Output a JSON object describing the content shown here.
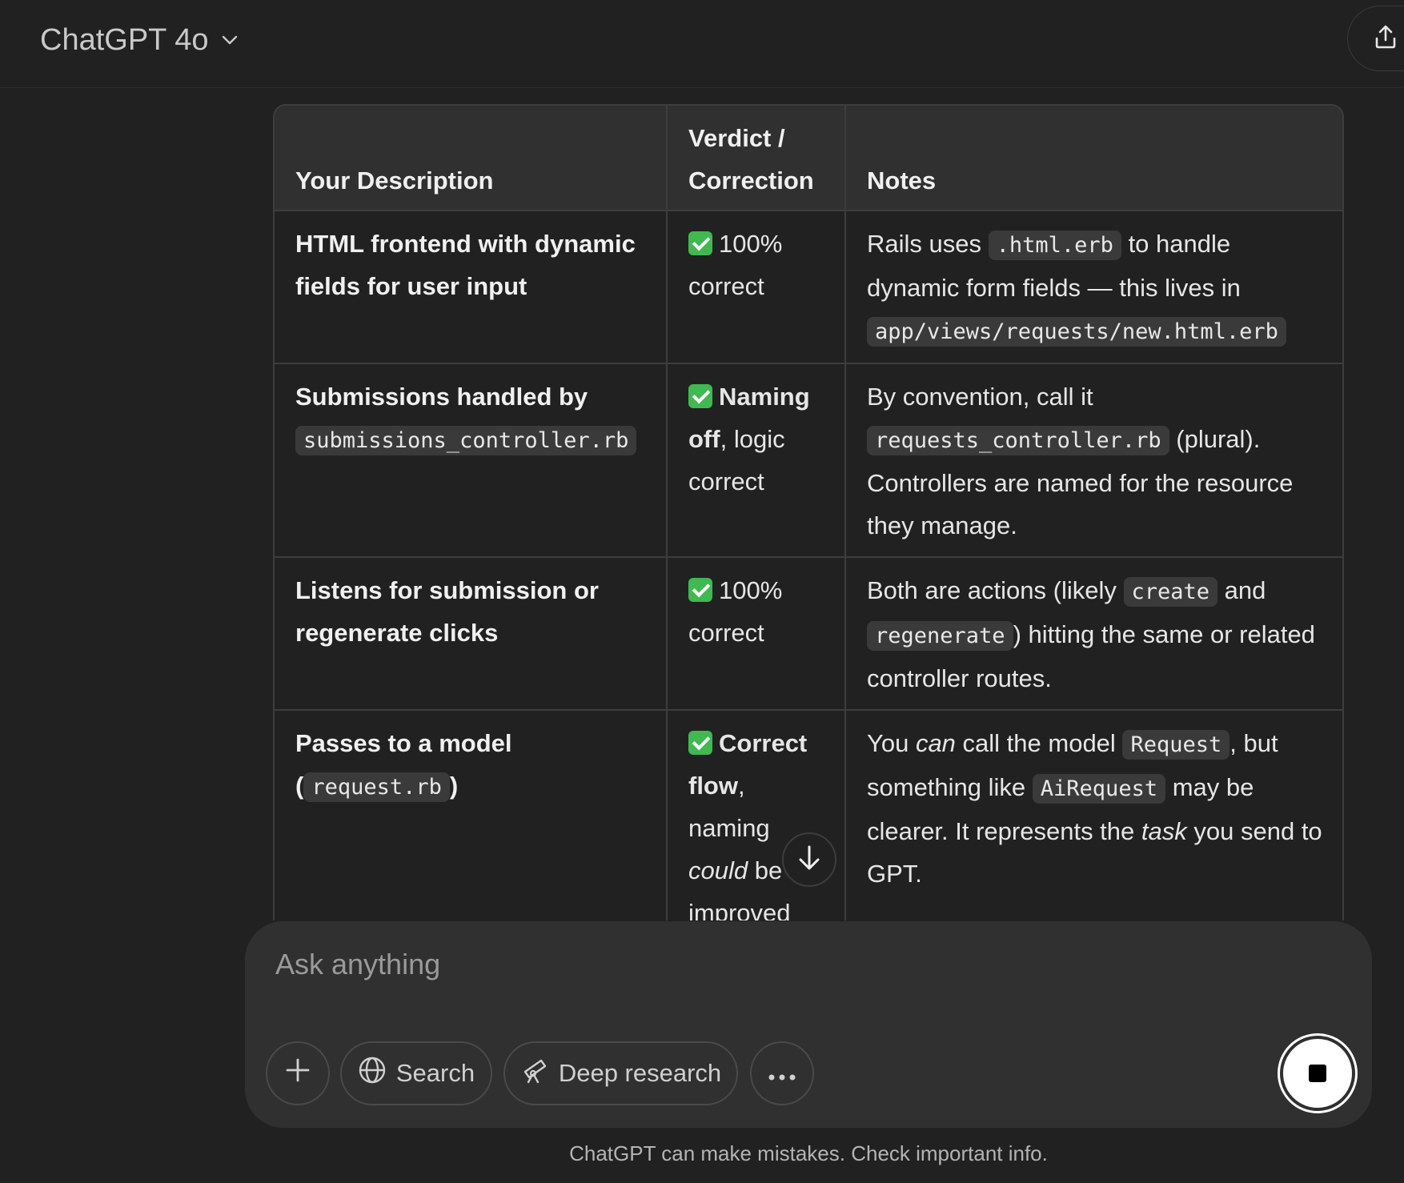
{
  "header": {
    "model_name": "ChatGPT 4o"
  },
  "table": {
    "headers": [
      "Your Description",
      "Verdict / Correction",
      "Notes"
    ],
    "rows": [
      {
        "description": "HTML frontend with dynamic fields for user input",
        "verdict": "100% correct",
        "notes": {
          "t1": "Rails uses",
          "code1": ".html.erb",
          "t2": "to handle dynamic form fields — this lives in",
          "code2": "app/views/requests/new.html.erb"
        }
      },
      {
        "description": {
          "t1": "Submissions handled by",
          "code1": "submissions_controller.rb"
        },
        "verdict": {
          "bold": "Naming off",
          "rest": ", logic correct"
        },
        "notes": {
          "t1": "By convention, call it",
          "code1": "requests_controller.rb",
          "t2": "(plural). Controllers are named for the resource they manage."
        }
      },
      {
        "description": "Listens for submission or regenerate clicks",
        "verdict": "100% correct",
        "notes": {
          "t1": "Both are actions (likely",
          "code1": "create",
          "t2": "and",
          "code2": "regenerate",
          "t3": ") hitting the same or related controller routes."
        }
      },
      {
        "description": {
          "t1": "Passes to a model",
          "code1": "request.rb"
        },
        "verdict": {
          "bold": "Correct flow",
          "t1": ", naming",
          "italic": "could",
          "t2": "be improved"
        },
        "notes": {
          "t1": "You",
          "italic1": "can",
          "t2": "call the model",
          "code1": "Request",
          "t3": ", but something like",
          "code2": "AiRequest",
          "t4": "may be clearer. It represents the",
          "italic2": "task",
          "t5": "you send to GPT."
        }
      }
    ]
  },
  "composer": {
    "placeholder": "Ask anything",
    "search_label": "Search",
    "deep_research_label": "Deep research"
  },
  "footer": {
    "disclaimer": "ChatGPT can make mistakes. Check important info."
  },
  "colors": {
    "background": "#212121",
    "header_row": "#303030",
    "composer": "#303030",
    "check_green": "#3fb950"
  },
  "icons": [
    "chevron-down-icon",
    "share-icon",
    "check-icon",
    "arrow-down-icon",
    "plus-icon",
    "globe-icon",
    "telescope-icon",
    "more-icon",
    "stop-icon"
  ]
}
